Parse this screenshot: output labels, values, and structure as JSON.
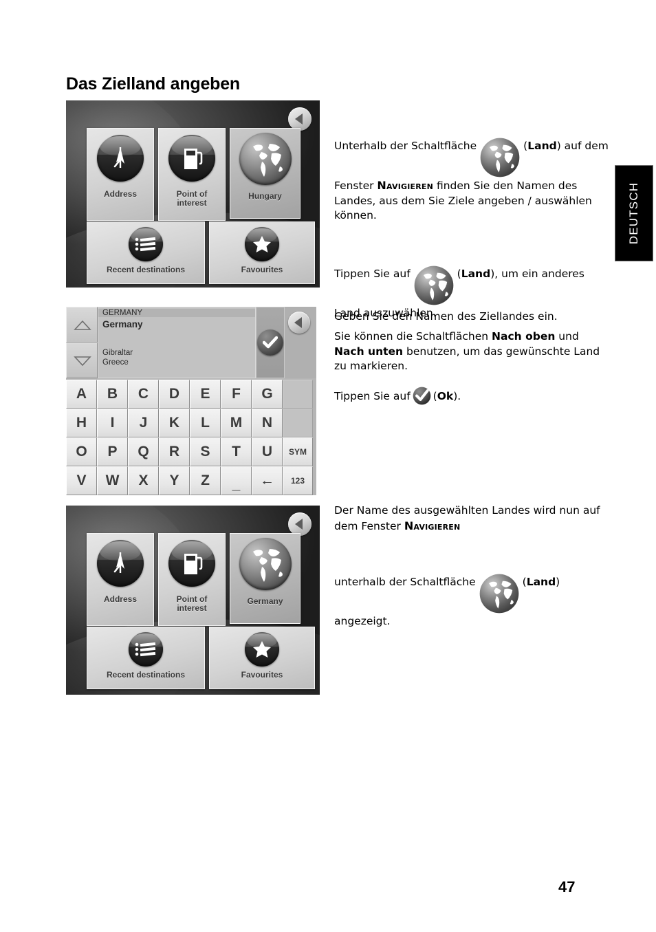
{
  "page": {
    "title": "Das Zielland angeben",
    "number": "47",
    "language_tab": "DEUTSCH"
  },
  "screenshot_navigate_hungary": {
    "name": "navigate-screen-hungary",
    "back_button": "back-arrow-icon",
    "tiles": [
      {
        "label": "Address",
        "icon": "address-flag-icon",
        "selected": false
      },
      {
        "label": "Point of\ninterest",
        "icon": "fuel-pump-icon",
        "selected": false
      },
      {
        "label": "Hungary",
        "icon": "globe-icon",
        "selected": true
      },
      {
        "label": "Recent destinations",
        "icon": "list-icon",
        "selected": false
      },
      {
        "label": "Favourites",
        "icon": "star-icon",
        "selected": false
      }
    ]
  },
  "screenshot_keyboard": {
    "name": "country-keyboard-screen",
    "scroll_up": "triangle-up-icon",
    "scroll_down": "triangle-down-icon",
    "ok_button": "check-icon",
    "back_button": "back-arrow-icon",
    "list": {
      "header": "GERMANY",
      "selected": "Germany",
      "items": [
        "Gibraltar",
        "Greece"
      ]
    },
    "keyboard_rows": [
      [
        "A",
        "B",
        "C",
        "D",
        "E",
        "F",
        "G",
        ""
      ],
      [
        "H",
        "I",
        "J",
        "K",
        "L",
        "M",
        "N",
        ""
      ],
      [
        "O",
        "P",
        "Q",
        "R",
        "S",
        "T",
        "U",
        "SYM"
      ],
      [
        "V",
        "W",
        "X",
        "Y",
        "Z",
        "_",
        "←",
        "123"
      ]
    ]
  },
  "screenshot_navigate_germany": {
    "name": "navigate-screen-germany",
    "back_button": "back-arrow-icon",
    "tiles": [
      {
        "label": "Address",
        "icon": "address-flag-icon",
        "selected": false
      },
      {
        "label": "Point of\ninterest",
        "icon": "fuel-pump-icon",
        "selected": false
      },
      {
        "label": "Germany",
        "icon": "globe-icon",
        "selected": true
      },
      {
        "label": "Recent destinations",
        "icon": "list-icon",
        "selected": false
      },
      {
        "label": "Favourites",
        "icon": "star-icon",
        "selected": false
      }
    ]
  },
  "body": {
    "p1_a": "Unterhalb der Schaltfläche",
    "p1_b": "(",
    "p1_bold": "Land",
    "p1_c": ") auf dem Fenster ",
    "p1_sc": "Navigieren",
    "p1_d": " finden Sie den Namen des Landes, aus dem Sie Ziele angeben / auswählen können.",
    "p2_a": "Tippen Sie auf",
    "p2_b": "(",
    "p2_bold": "Land",
    "p2_c": "), um ein anderes Land auszuwählen.",
    "p3": "Geben Sie den Namen des Ziellandes ein.",
    "p4_a": "Sie können die Schaltflächen ",
    "p4_bold1": "Nach oben",
    "p4_b": " und ",
    "p4_bold2": "Nach unten",
    "p4_c": " benutzen, um das gewünschte Land zu markieren.",
    "p5_a": "Tippen Sie auf",
    "p5_b": "(",
    "p5_bold": "Ok",
    "p5_c": ").",
    "p6_a": "Der Name des ausgewählten Landes wird nun auf dem Fenster ",
    "p6_sc": "Navigieren",
    "p7_a": "unterhalb der Schaltfläche",
    "p7_b": "(",
    "p7_bold": "Land",
    "p7_c": ") angezeigt."
  },
  "colors": {
    "page_bg": "#ffffff",
    "text": "#000000",
    "tab_bg": "#000000",
    "tab_text": "#ffffff",
    "tile_face": "#d8d8d8",
    "tile_selected": "#b6b6b6",
    "key_face": "#ebebeb",
    "device_bg": "#3a3a3a"
  }
}
